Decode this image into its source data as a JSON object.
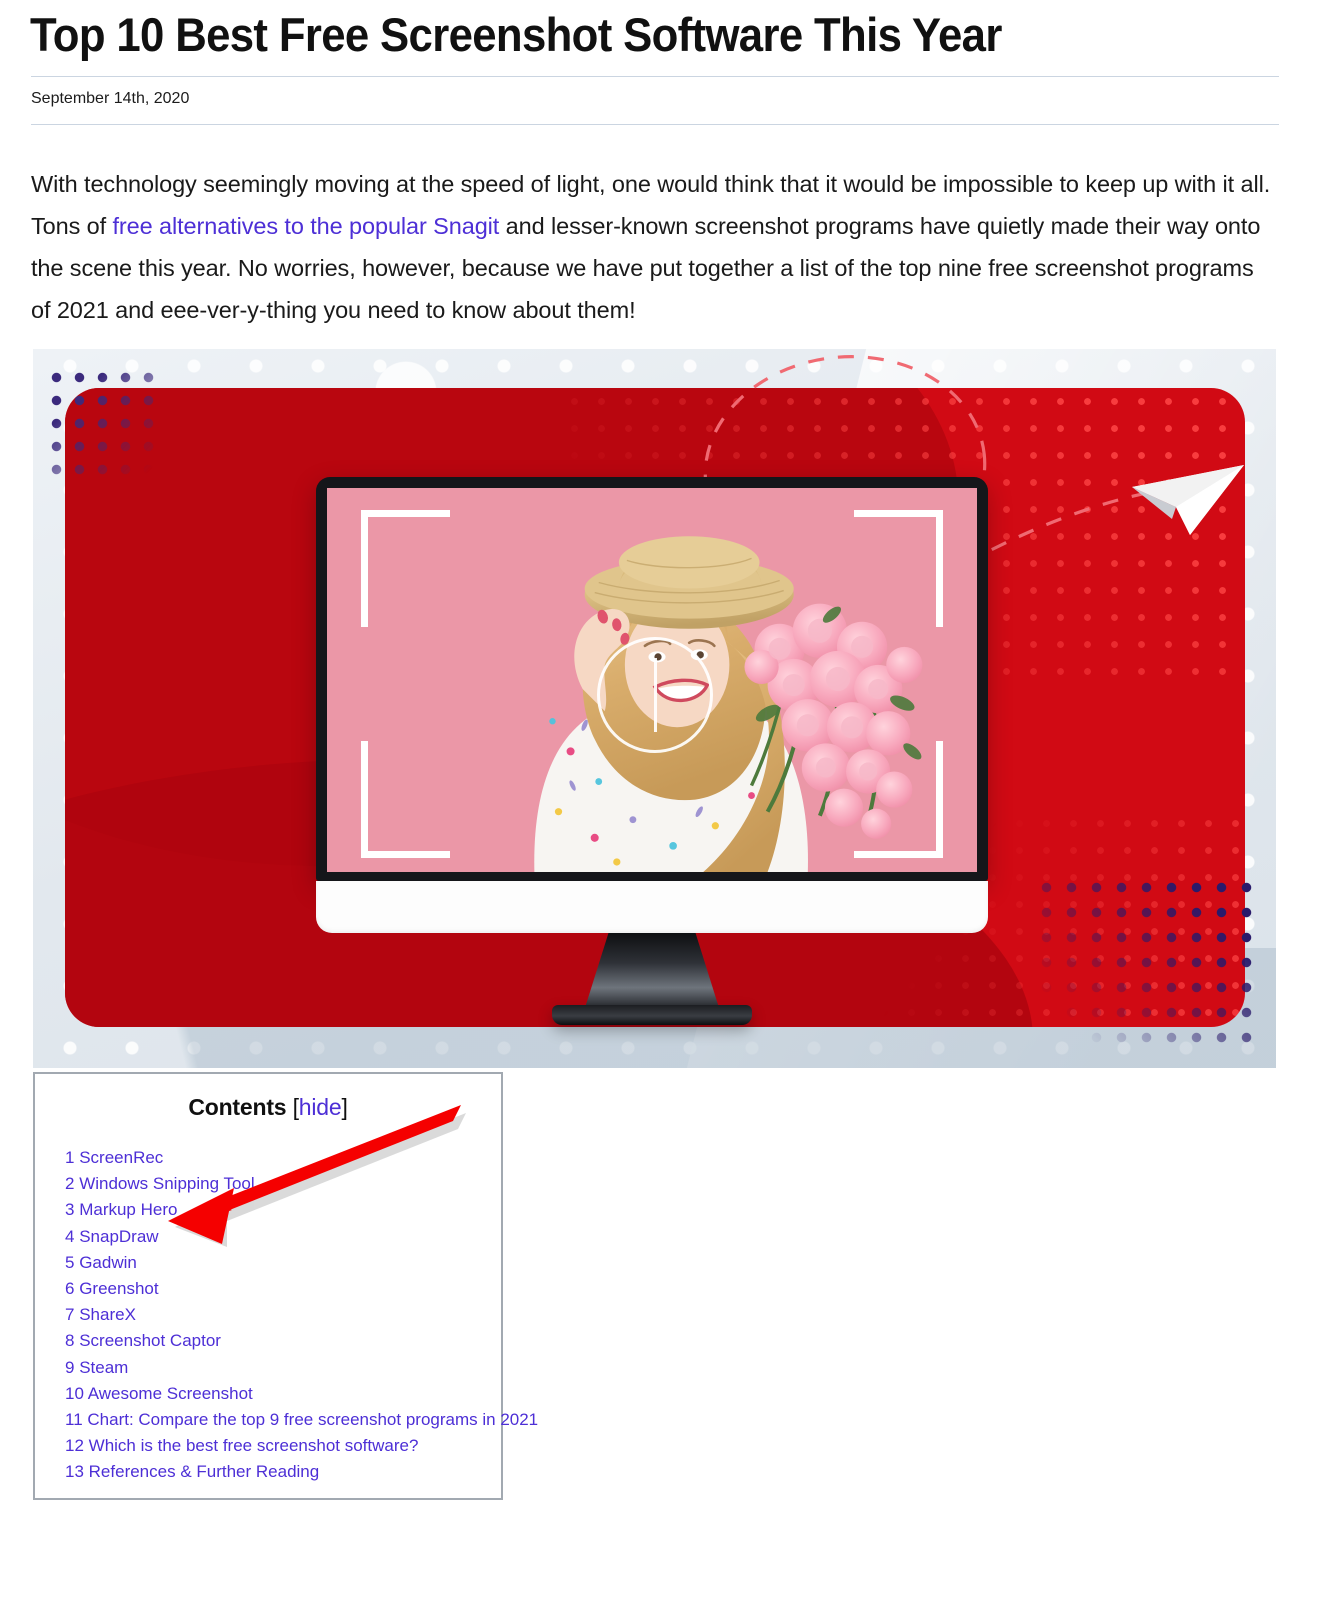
{
  "article": {
    "title": "Top 10 Best Free Screenshot Software This Year",
    "date": "September 14th, 2020",
    "intro_part_1": "With technology seemingly moving at the speed of light, one would think that it would be impossible to keep up with it all. Tons of ",
    "intro_link": "free alternatives to the popular Snagit",
    "intro_part_2": " and lesser-known screenshot programs have quietly made their way onto the scene this year. No worries, however, because we have put together a list of the top nine free screenshot programs of 2021 and eee-ver-y-thing you need to know about them!"
  },
  "hero_image": {
    "alt": "Red banner with desktop monitor showing a photo of a smiling woman in a straw hat holding pink carnations, with camera viewfinder overlay",
    "colors": {
      "panel_red": "#d10a14",
      "panel_red_dark": "#b3060f",
      "dot_navy": "#3b2a7d",
      "background": "#e3e9ef",
      "photo_pink": "#ea94a4"
    }
  },
  "toc": {
    "heading": "Contents",
    "bracket_open": "[",
    "hide_label": "hide",
    "bracket_close": "]",
    "items": [
      {
        "num": "1",
        "label": "ScreenRec"
      },
      {
        "num": "2",
        "label": "Windows Snipping Tool"
      },
      {
        "num": "3",
        "label": "Markup Hero"
      },
      {
        "num": "4",
        "label": "SnapDraw"
      },
      {
        "num": "5",
        "label": "Gadwin"
      },
      {
        "num": "6",
        "label": "Greenshot"
      },
      {
        "num": "7",
        "label": "ShareX"
      },
      {
        "num": "8",
        "label": "Screenshot Captor"
      },
      {
        "num": "9",
        "label": "Steam"
      },
      {
        "num": "10",
        "label": "Awesome Screenshot"
      },
      {
        "num": "11",
        "label": "Chart: Compare the top 9 free screenshot programs in 2021"
      },
      {
        "num": "12",
        "label": "Which is the best free screenshot software?"
      },
      {
        "num": "13",
        "label": "References & Further Reading"
      }
    ]
  },
  "annotation": {
    "type": "arrow",
    "color": "#f50000",
    "points_to": "3 Markup Hero"
  },
  "theme": {
    "link_color": "#4d2fd6",
    "rule_color": "#cbd5e1",
    "toc_border": "#a2a9b1"
  }
}
